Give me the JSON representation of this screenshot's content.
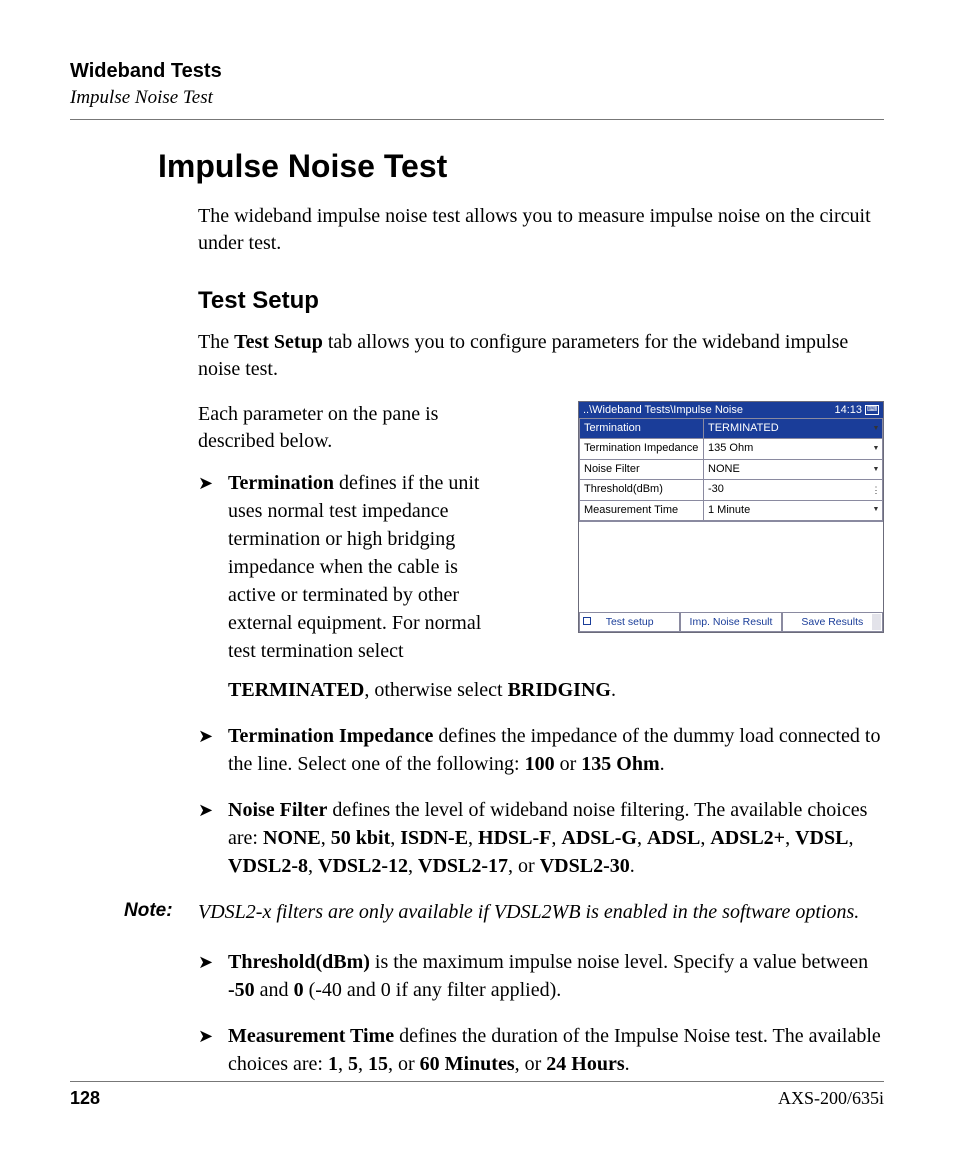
{
  "header": {
    "chapter": "Wideband Tests",
    "section": "Impulse Noise Test"
  },
  "title": "Impulse Noise Test",
  "intro": "The wideband impulse noise test allows you to measure impulse noise on the circuit under test.",
  "subhead": "Test Setup",
  "setup_para_pre": "The ",
  "setup_para_bold": "Test Setup",
  "setup_para_post": " tab allows you to configure parameters for the wideband impulse noise test.",
  "each_param": "Each parameter on the pane is described below.",
  "screenshot": {
    "breadcrumb": "..\\Wideband Tests\\Impulse Noise",
    "time": "14:13",
    "rows": [
      {
        "label": "Termination",
        "value": "TERMINATED",
        "hl": true
      },
      {
        "label": "Termination Impedance",
        "value": "135 Ohm",
        "hl": false
      },
      {
        "label": "Noise Filter",
        "value": "NONE",
        "hl": false
      },
      {
        "label": "Threshold(dBm)",
        "value": "-30",
        "hl": false,
        "no_dd": true
      },
      {
        "label": "Measurement Time",
        "value": "1 Minute",
        "hl": false
      }
    ],
    "tabs": [
      "Test setup",
      "Imp. Noise Result",
      "Save Results"
    ]
  },
  "bullets": {
    "b1_bold": "Termination",
    "b1_a": " defines if the unit uses normal test impedance termination or high bridging impedance when the cable is active or terminated by other external equipment. For normal test termination select ",
    "b1_term": "TERMINATED",
    "b1_b": ", otherwise select ",
    "b1_bridge": "BRIDGING",
    "b1_c": ".",
    "b2_bold": "Termination Impedance",
    "b2_a": " defines the impedance of the dummy load connected to the line. Select one of the following: ",
    "b2_v1": "100",
    "b2_or": " or ",
    "b2_v2": "135 Ohm",
    "b2_c": ".",
    "b3_bold": "Noise Filter",
    "b3_a": " defines the level of wideband noise filtering. The available choices are: ",
    "b3_v1": "NONE",
    "b3_s": ", ",
    "b3_v2": "50 kbit",
    "b3_v3": "ISDN-E",
    "b3_v4": "HDSL-F",
    "b3_v5": "ADSL-G",
    "b3_v6": "ADSL",
    "b3_v7": "ADSL2+",
    "b3_v8": "VDSL",
    "b3_v9": "VDSL2-8",
    "b3_v10": "VDSL2-12",
    "b3_v11": "VDSL2-17",
    "b3_or": ", or ",
    "b3_v12": "VDSL2-30",
    "b3_c": ".",
    "b4_bold": "Threshold(dBm)",
    "b4_a": " is the maximum impulse noise level. Specify a value between ",
    "b4_v1": "-50",
    "b4_and": " and ",
    "b4_v2": "0",
    "b4_b": " (-40 and 0 if any filter applied).",
    "b5_bold": "Measurement Time",
    "b5_a": " defines the duration of the Impulse Noise test. The available choices are: ",
    "b5_v1": "1",
    "b5_s": ", ",
    "b5_v2": "5",
    "b5_v3": "15",
    "b5_or": ", or ",
    "b5_v4": "60 Minutes",
    "b5_or2": ", or ",
    "b5_v5": "24 Hours",
    "b5_c": "."
  },
  "note": {
    "label": "Note:",
    "body": "VDSL2-x filters are only available if VDSL2WB is enabled in the software options."
  },
  "footer": {
    "page": "128",
    "model": "AXS-200/635i"
  }
}
